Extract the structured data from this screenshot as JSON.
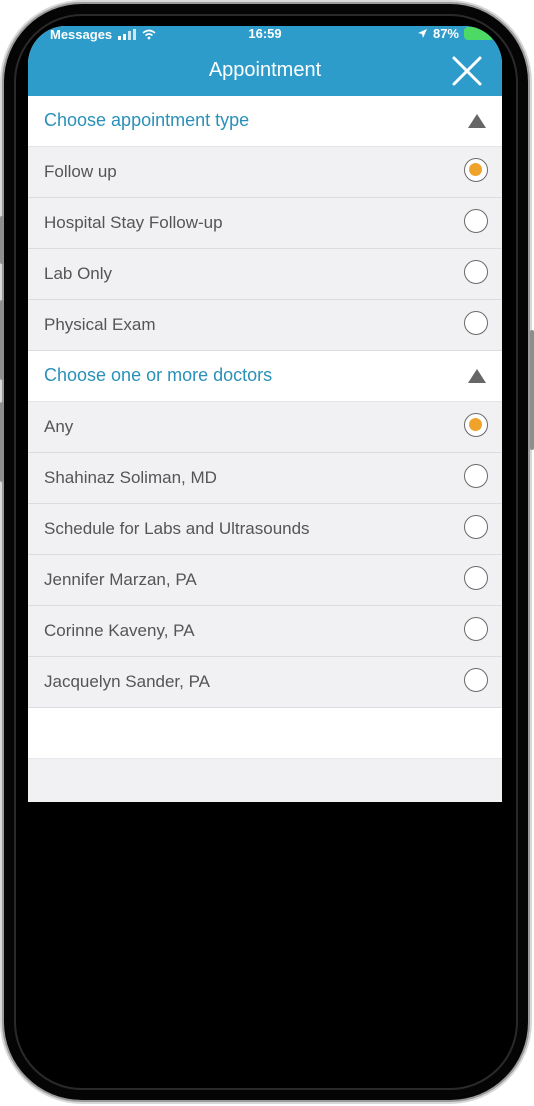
{
  "status_bar": {
    "carrier": "Messages",
    "time": "16:59",
    "battery": "87%",
    "signal_icon": "signal-icon",
    "wifi_icon": "wifi-icon",
    "location_icon": "location-arrow-icon"
  },
  "header": {
    "title": "Appointment",
    "close_icon": "close-icon"
  },
  "appointment_section": {
    "title": "Choose appointment type",
    "items": [
      {
        "label": "Follow up",
        "selected": true
      },
      {
        "label": "Hospital Stay Follow-up",
        "selected": false
      },
      {
        "label": "Lab Only",
        "selected": false
      },
      {
        "label": "Physical Exam",
        "selected": false
      }
    ]
  },
  "doctors_section": {
    "title": "Choose one or more doctors",
    "items": [
      {
        "label": "Any",
        "selected": true
      },
      {
        "label": "Shahinaz Soliman, MD",
        "selected": false
      },
      {
        "label": "Schedule for Labs and Ultrasounds",
        "selected": false
      },
      {
        "label": "Jennifer Marzan, PA",
        "selected": false
      },
      {
        "label": "Corinne Kaveny, PA",
        "selected": false
      },
      {
        "label": "Jacquelyn Sander, PA",
        "selected": false
      }
    ]
  },
  "colors": {
    "accent": "#2d9cca",
    "section_title": "#2a90b8",
    "radio_selected": "#f0a32b"
  }
}
